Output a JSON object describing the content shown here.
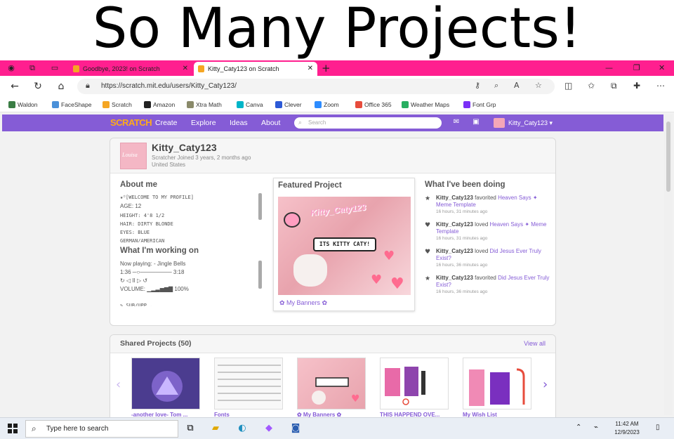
{
  "headline": "So Many Projects!",
  "browser": {
    "tabs": [
      {
        "title": "Goodbye, 2023! on Scratch",
        "active": false
      },
      {
        "title": "Kitty_Caty123 on Scratch",
        "active": true
      }
    ],
    "url": "https://scratch.mit.edu/users/Kitty_Caty123/",
    "bookmarks": [
      {
        "label": "Waldon",
        "color": "#3a7d44"
      },
      {
        "label": "FaceShape",
        "color": "#4a90d9"
      },
      {
        "label": "Scratch",
        "color": "#f5a623"
      },
      {
        "label": "Amazon",
        "color": "#222222"
      },
      {
        "label": "Xtra Math",
        "color": "#8a8a6a"
      },
      {
        "label": "Canva",
        "color": "#00b5c8"
      },
      {
        "label": "Clever",
        "color": "#2d5ad6"
      },
      {
        "label": "Zoom",
        "color": "#2d8cff"
      },
      {
        "label": "Office 365",
        "color": "#e74c3c"
      },
      {
        "label": "Weather Maps",
        "color": "#27ae60"
      },
      {
        "label": "Font Grp",
        "color": "#7b2ff7"
      }
    ]
  },
  "scratch_nav": {
    "logo": "SCRATCH",
    "links": [
      "Create",
      "Explore",
      "Ideas",
      "About"
    ],
    "search_placeholder": "Search",
    "username": "Kitty_Caty123 ▾",
    "accent": "#855cd6"
  },
  "profile": {
    "avatar_text": "Louisa",
    "username": "Kitty_Caty123",
    "role_line": "Scratcher    Joined 3 years, 2 months ago",
    "country": "United States",
    "about_title": "About me",
    "about_lines": [
      "★꙳[WELCOME TO MY PROFILE]",
      "AGE: 12",
      "HEIGHT: 4'8 1/2",
      "HAIR: DIRTY BLONDE",
      "EYES: BLUE",
      "GERMAN/AMERICAN"
    ],
    "working_title": "What I'm working on",
    "working_lines": [
      "Now playing: - Jingle Bells",
      "1:36 ─○──────── 3:18",
      "↻ ◁ II ▷ ↺",
      "VOLUME: ▁▂▃▅▆▇ 100%",
      "",
      "✎ SUB/UPP..."
    ],
    "featured_title": "Featured Project",
    "featured_thumb_title": "Kitty_Caty123",
    "featured_bubble": "ITS KITTY CATY!",
    "featured_link": "✿ My Banners ✿",
    "activity_title": "What I've been doing",
    "activity": [
      {
        "icon": "★",
        "user": "Kitty_Caty123",
        "verb": "favorited",
        "target": "Heaven Says ✦ Meme Template",
        "time": "16 hours, 31 minutes ago"
      },
      {
        "icon": "♥",
        "user": "Kitty_Caty123",
        "verb": "loved",
        "target": "Heaven Says ✦ Meme Template",
        "time": "16 hours, 31 minutes ago"
      },
      {
        "icon": "♥",
        "user": "Kitty_Caty123",
        "verb": "loved",
        "target": "Did Jesus Ever Truly Exist?",
        "time": "16 hours, 36 minutes ago"
      },
      {
        "icon": "★",
        "user": "Kitty_Caty123",
        "verb": "favorited",
        "target": "Did Jesus Ever Truly Exist?",
        "time": "16 hours, 36 minutes ago"
      }
    ]
  },
  "shared": {
    "title": "Shared Projects (50)",
    "view_all": "View all",
    "projects": [
      {
        "title": "-another love- Tom ...",
        "bg": "#4b3c8f"
      },
      {
        "title": "Fonts",
        "bg": "#f4f4f4"
      },
      {
        "title": "✿ My Banners ✿",
        "bg": "#f3bcc6"
      },
      {
        "title": "THIS HAPPEND OVE...",
        "bg": "#ffffff"
      },
      {
        "title": "My Wish List",
        "bg": "#ffffff"
      }
    ]
  },
  "taskbar": {
    "search_placeholder": "Type here to search",
    "time": "11:42 AM",
    "date": "12/9/2023"
  }
}
